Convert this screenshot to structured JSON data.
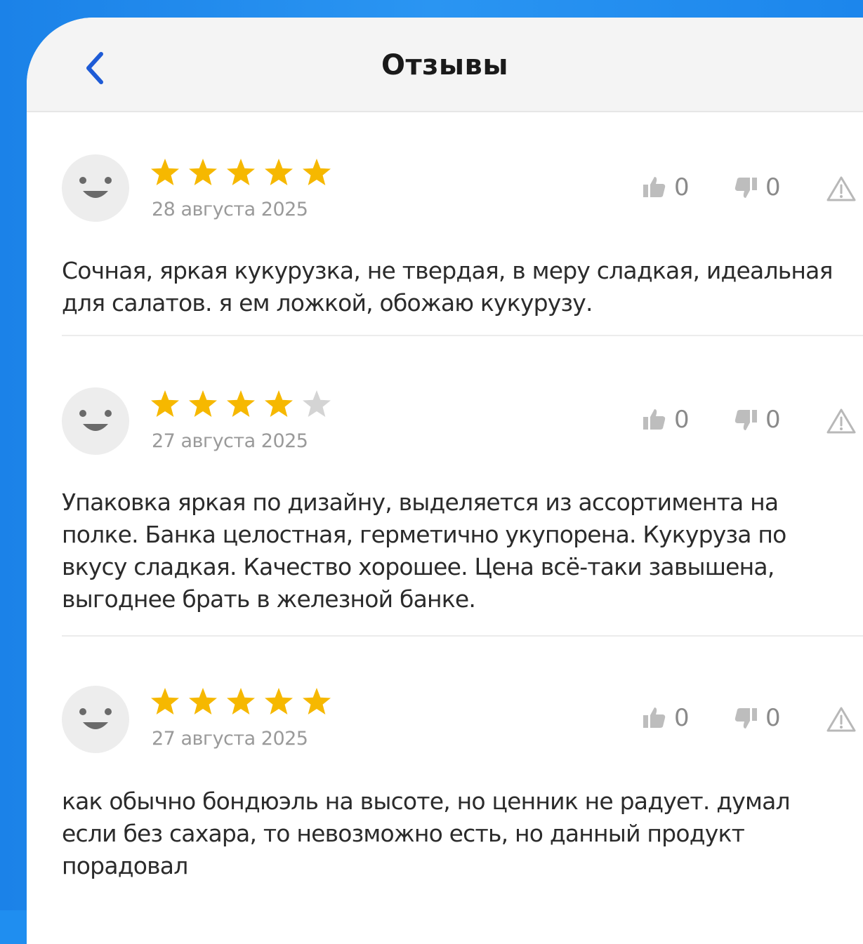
{
  "header": {
    "title": "Отзывы"
  },
  "colors": {
    "star_filled": "#f6b800",
    "star_empty": "#d4d4d4",
    "back_arrow": "#1e5bd6"
  },
  "reviews": [
    {
      "rating": 5,
      "date": "28 августа 2025",
      "likes": "0",
      "dislikes": "0",
      "text": "Сочная, яркая кукурузка, не твердая, в меру сладкая, идеальная для салатов. я ем ложкой, обожаю кукурузу."
    },
    {
      "rating": 4,
      "date": "27 августа 2025",
      "likes": "0",
      "dislikes": "0",
      "text": "Упаковка яркая по дизайну, выделяется из ассортимента на полке. Банка целостная, герметично укупорена. Кукуруза по вкусу сладкая. Качество хорошее. Цена всё-таки завышена, выгоднее брать в железной банке."
    },
    {
      "rating": 5,
      "date": "27 августа 2025",
      "likes": "0",
      "dislikes": "0",
      "text": "как обычно бондюэль на высоте, но ценник не радует. думал если без сахара, то невозможно есть, но данный продукт порадовал"
    }
  ]
}
